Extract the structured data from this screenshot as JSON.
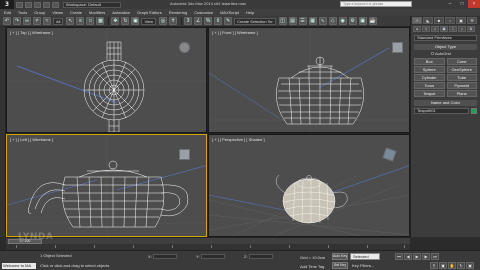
{
  "titlebar": {
    "logo": "3",
    "workspace": "Workspace: Default",
    "title": "Autodesk 3ds Max 2014 x64     teaarttea.max",
    "search_placeholder": "Type a keyword or phrase"
  },
  "menu": [
    "Edit",
    "Tools",
    "Group",
    "Views",
    "Create",
    "Modifiers",
    "Animation",
    "Graph Editors",
    "Rendering",
    "Customize",
    "MAXScript",
    "Help"
  ],
  "toolbar": {
    "filter": "All",
    "view": "View",
    "snap_count": "3",
    "named_selection": "Create Selection Se"
  },
  "viewports": {
    "top_label": "[ + ] [ Top ] [ Wireframe ]",
    "front_label": "[ + ] [ Front ] [ Wireframe ]",
    "left_label": "[ + ] [ Left ] [ Wireframe ]",
    "persp_label": "[ + ] [ Perspective ] [ Shaded ]"
  },
  "command_panel": {
    "tabs": [
      "+",
      "◣",
      "■",
      "○",
      "▣",
      "⚒"
    ],
    "dropdown": "Standard Primitives",
    "object_type_header": "Object Type",
    "autogrid": "AutoGrid",
    "objects": [
      "Box",
      "Cone",
      "Sphere",
      "GeoSphere",
      "Cylinder",
      "Tube",
      "Torus",
      "Pyramid",
      "Teapot",
      "Plane"
    ],
    "name_color_header": "Name and Color",
    "name_value": "Teapot001",
    "swatch_color": "#1d9e5a"
  },
  "timeline": {
    "position": "0 / 100",
    "ticks": [
      "0",
      "10",
      "20",
      "30",
      "40",
      "50",
      "60",
      "70",
      "80",
      "90",
      "100"
    ]
  },
  "status": {
    "welcome": "Welcome to MA",
    "objects_selected": "1 Object Selected",
    "prompt": "Click or click-and-drag to select objects",
    "x_label": "X:",
    "y_label": "Y:",
    "z_label": "Z:",
    "grid": "Grid = 10.0cm",
    "auto_key": "Auto Key",
    "selected": "Selected",
    "set_key": "Set Key",
    "key_filters": "Key Filters...",
    "add_time_tag": "Add Time Tag"
  },
  "watermark": "LYNDA"
}
